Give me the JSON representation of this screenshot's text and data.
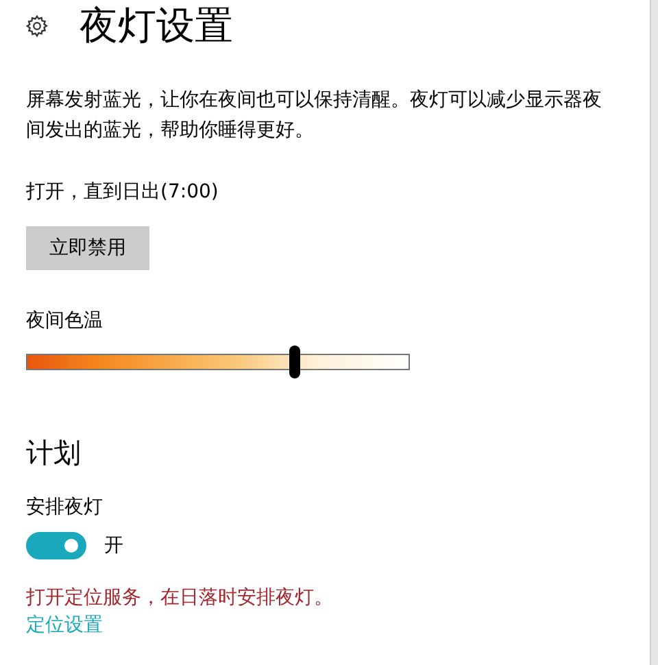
{
  "header": {
    "title": "夜灯设置"
  },
  "description": "屏幕发射蓝光，让你在夜间也可以保持清醒。夜灯可以减少显示器夜间发出的蓝光，帮助你睡得更好。",
  "status": "打开，直到日出(7:00)",
  "disable_button": {
    "label": "立即禁用"
  },
  "color_temperature": {
    "label": "夜间色温",
    "level": 0.7
  },
  "schedule": {
    "heading": "计划",
    "label": "安排夜灯",
    "toggle": {
      "on": true,
      "label": "开"
    },
    "warning": "打开定位服务，在日落时安排夜灯。",
    "link": "定位设置"
  }
}
